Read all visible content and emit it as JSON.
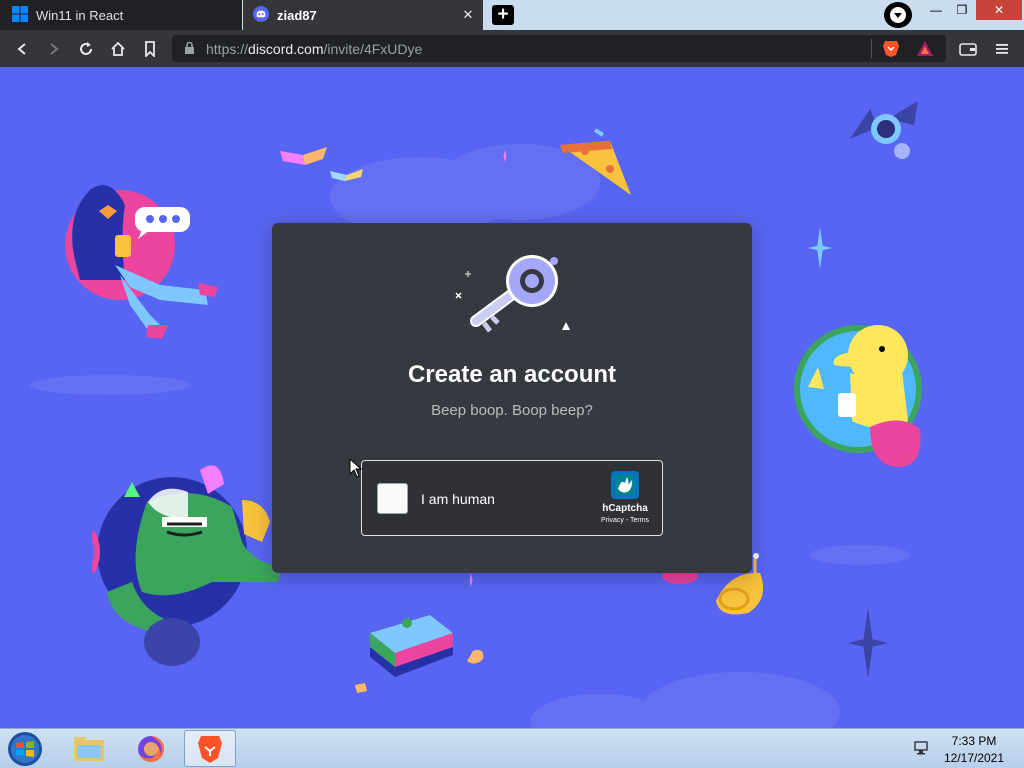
{
  "tabs": [
    {
      "title": "Win11 in React",
      "icon": "windows-icon",
      "active": false
    },
    {
      "title": "ziad87",
      "icon": "discord-icon",
      "active": true
    }
  ],
  "tab_close_glyph": "✕",
  "new_tab_glyph": "+",
  "window_controls": {
    "minimize": "—",
    "maximize": "❐",
    "close": "✕"
  },
  "address_bar": {
    "scheme": "https://",
    "host": "discord.com",
    "path": "/invite/4FxUDye"
  },
  "icons": {
    "back": "back-arrow-icon",
    "forward": "forward-arrow-icon",
    "reload": "reload-icon",
    "home": "home-icon",
    "bookmark": "bookmark-icon",
    "lock": "lock-icon",
    "brave_shields": "brave-lion-icon",
    "brave_rewards": "brave-rewards-icon",
    "wallet": "wallet-icon",
    "menu": "hamburger-menu-icon"
  },
  "page": {
    "title": "Create an account",
    "subtitle": "Beep boop. Boop beep?",
    "captcha": {
      "label": "I am human",
      "brand": "hCaptcha",
      "links": "Privacy - Terms"
    }
  },
  "taskbar": {
    "apps": [
      "windows-explorer-icon",
      "firefox-icon",
      "brave-icon"
    ],
    "time": "7:33 PM",
    "date": "12/17/2021"
  },
  "colors": {
    "discord_blurple": "#5865f2",
    "card_bg": "#36393f",
    "browser_chrome": "#35363a",
    "close_button": "#c7443a"
  }
}
